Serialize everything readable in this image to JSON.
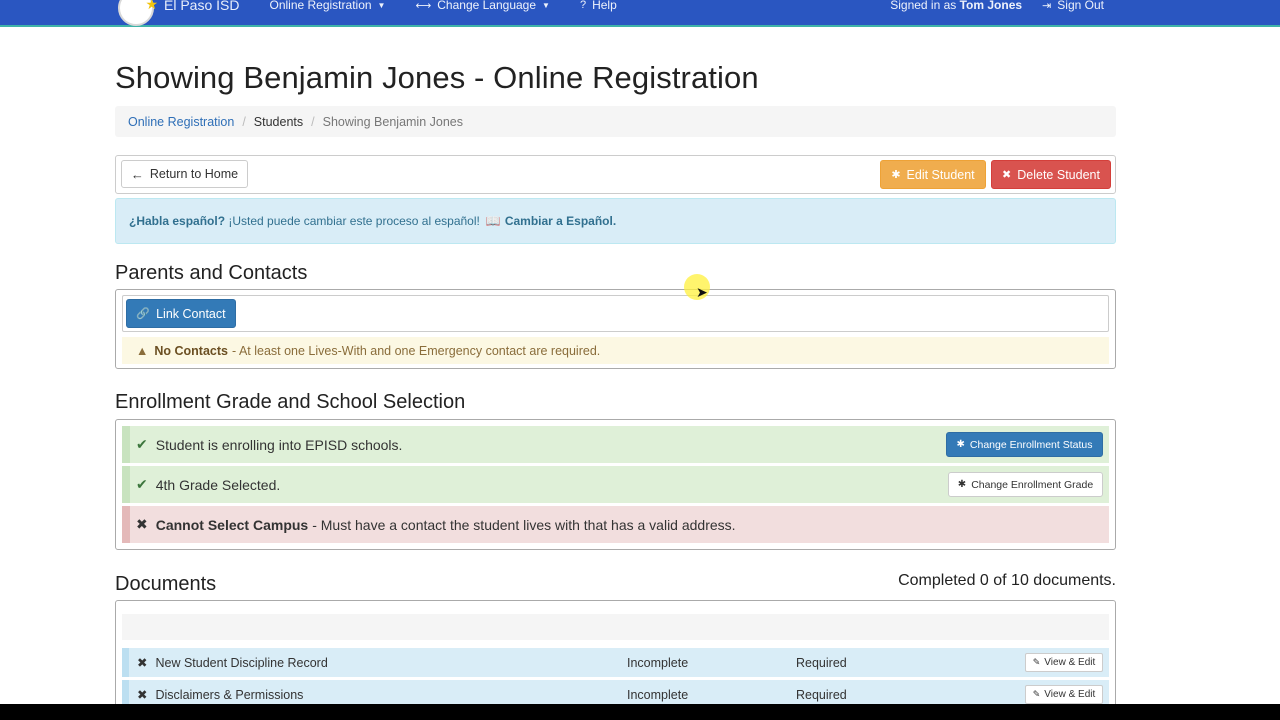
{
  "navbar": {
    "brand": "El Paso ISD",
    "online_registration": "Online Registration",
    "change_language": "Change Language",
    "help": "Help",
    "signed_in_prefix": "Signed in as",
    "signed_in_user": "Tom Jones",
    "sign_out": "Sign Out"
  },
  "page_title": "Showing Benjamin Jones - Online Registration",
  "breadcrumb": {
    "home": "Online Registration",
    "students": "Students",
    "current": "Showing Benjamin Jones"
  },
  "toolbar": {
    "return_home": "Return to Home",
    "edit_student": "Edit Student",
    "delete_student": "Delete Student"
  },
  "language_alert": {
    "question": "¿Habla español?",
    "text": "¡Usted puede cambiar este proceso al español!",
    "link": "Cambiar a Español."
  },
  "contacts": {
    "heading": "Parents and Contacts",
    "link_contact": "Link Contact",
    "warning_title": "No Contacts",
    "warning_text": "- At least one Lives-With and one Emergency contact are required."
  },
  "enrollment": {
    "heading": "Enrollment Grade and School Selection",
    "row1_text": "Student is enrolling into EPISD schools.",
    "row1_button": "Change Enrollment Status",
    "row2_text": "4th Grade Selected.",
    "row2_button": "Change Enrollment Grade",
    "row3_title": "Cannot Select Campus",
    "row3_text": "- Must have a contact the student lives with that has a valid address."
  },
  "documents": {
    "heading": "Documents",
    "completed": "Completed 0 of 10 documents.",
    "rows": [
      {
        "name": "New Student Discipline Record",
        "status": "Incomplete",
        "requirement": "Required",
        "action": "View & Edit"
      },
      {
        "name": "Disclaimers & Permissions",
        "status": "Incomplete",
        "requirement": "Required",
        "action": "View & Edit"
      }
    ]
  },
  "colors": {
    "navbar": "#2a56c1",
    "primary": "#337ab7",
    "warning": "#f0ad4e",
    "danger": "#d9534f",
    "success_bg": "#dff0d8",
    "danger_bg": "#f2dede",
    "info_bg": "#d9edf7",
    "warn_bg": "#fcf8e3"
  }
}
